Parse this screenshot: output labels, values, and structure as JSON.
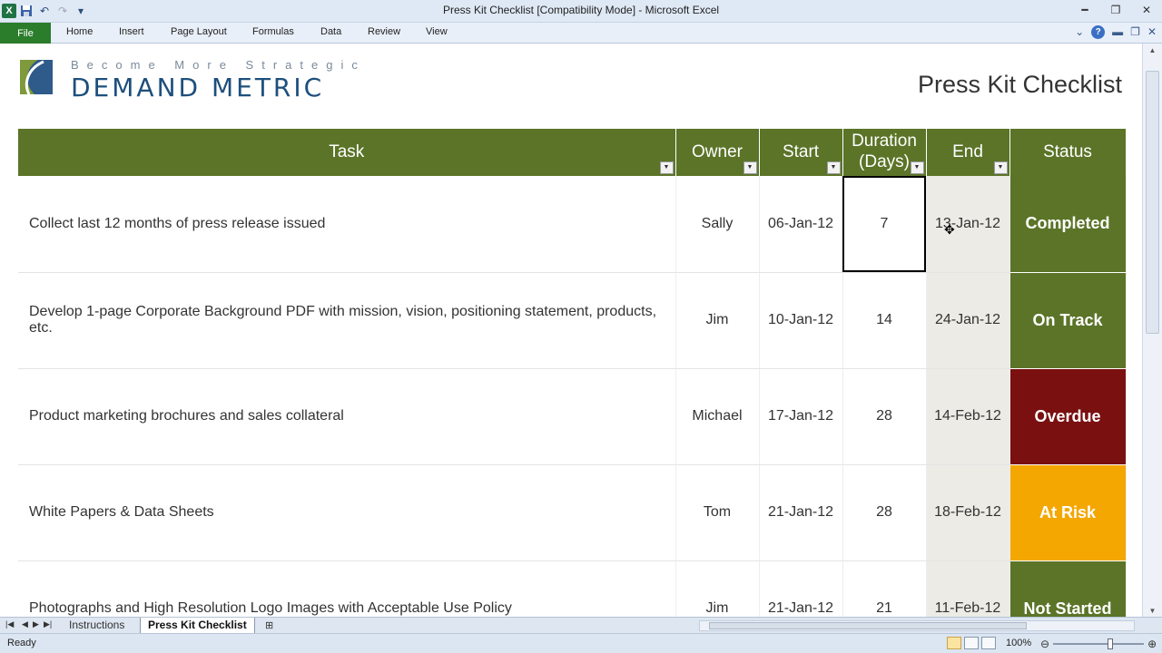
{
  "window": {
    "title": "Press Kit Checklist  [Compatibility Mode]  -  Microsoft Excel",
    "app_icon": "excel-icon",
    "qat_icons": [
      "save-icon",
      "undo-icon",
      "redo-icon",
      "customize-icon"
    ]
  },
  "ribbon": {
    "tabs": [
      "File",
      "Home",
      "Insert",
      "Page Layout",
      "Formulas",
      "Data",
      "Review",
      "View"
    ]
  },
  "sheet": {
    "logo_tagline": "Become More Strategic",
    "logo_name": "DEMAND METRIC",
    "title": "Press Kit Checklist",
    "columns": [
      "Task",
      "Owner",
      "Start",
      "Duration (Days)",
      "End",
      "Status"
    ],
    "rows": [
      {
        "task": "Collect last 12 months of press release issued",
        "owner": "Sally",
        "start": "06-Jan-12",
        "duration": "7",
        "end": "13-Jan-12",
        "status": "Completed"
      },
      {
        "task": "Develop 1-page Corporate Background PDF with mission, vision, positioning statement, products, etc.",
        "owner": "Jim",
        "start": "10-Jan-12",
        "duration": "14",
        "end": "24-Jan-12",
        "status": "On Track"
      },
      {
        "task": "Product marketing brochures and sales collateral",
        "owner": "Michael",
        "start": "17-Jan-12",
        "duration": "28",
        "end": "14-Feb-12",
        "status": "Overdue"
      },
      {
        "task": "White Papers & Data Sheets",
        "owner": "Tom",
        "start": "21-Jan-12",
        "duration": "28",
        "end": "18-Feb-12",
        "status": "At Risk"
      },
      {
        "task": "Photographs and High Resolution Logo Images with Acceptable Use Policy",
        "owner": "Jim",
        "start": "21-Jan-12",
        "duration": "21",
        "end": "11-Feb-12",
        "status": "Not Started"
      }
    ],
    "status_colors": {
      "Completed": "#5b7428",
      "On Track": "#5b7428",
      "Overdue": "#7a1010",
      "At Risk": "#f4a700",
      "Not Started": "#5b7428"
    },
    "header_color": "#5b7428"
  },
  "sheet_tabs": [
    "Instructions",
    "Press Kit Checklist"
  ],
  "active_sheet": "Press Kit Checklist",
  "statusbar": {
    "status": "Ready",
    "zoom": "100%"
  }
}
